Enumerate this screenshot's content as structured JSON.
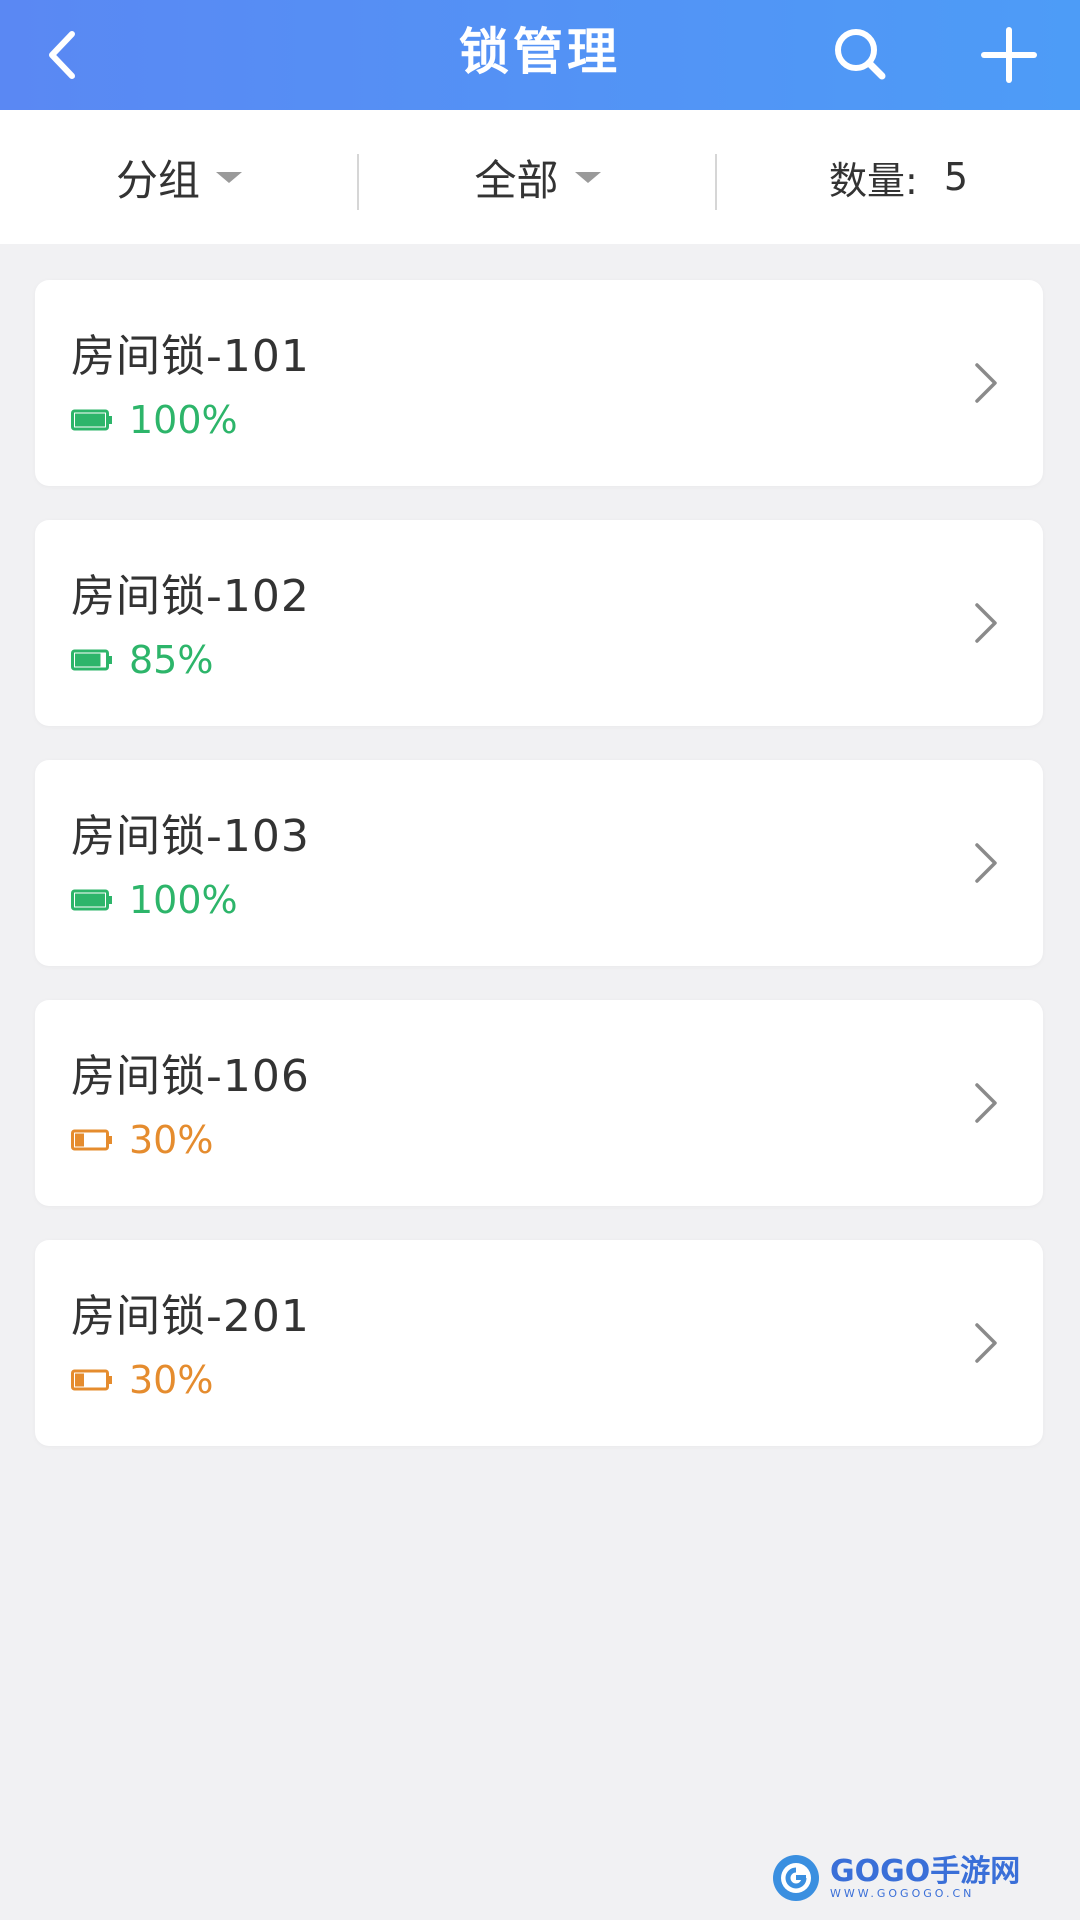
{
  "header": {
    "title": "锁管理"
  },
  "filters": {
    "group_label": "分组",
    "all_label": "全部",
    "count_label": "数量:",
    "count_value": "5"
  },
  "locks": [
    {
      "name": "房间锁-101",
      "battery": "100%",
      "level": 1.0,
      "status": "full"
    },
    {
      "name": "房间锁-102",
      "battery": "85%",
      "level": 0.85,
      "status": "full"
    },
    {
      "name": "房间锁-103",
      "battery": "100%",
      "level": 1.0,
      "status": "full"
    },
    {
      "name": "房间锁-106",
      "battery": "30%",
      "level": 0.3,
      "status": "low"
    },
    {
      "name": "房间锁-201",
      "battery": "30%",
      "level": 0.3,
      "status": "low"
    }
  ],
  "colors": {
    "header_bg": "#5a8ff5",
    "battery_ok": "#2db56a",
    "battery_low": "#e58c2e"
  },
  "watermark": {
    "text": "GOGO手游网",
    "sub": "WWW.GOGOGO.CN"
  }
}
